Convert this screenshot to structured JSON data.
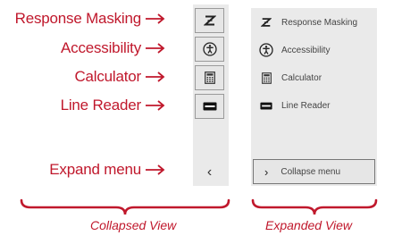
{
  "callouts": [
    {
      "label": "Response Masking"
    },
    {
      "label": "Accessibility"
    },
    {
      "label": "Calculator"
    },
    {
      "label": "Line Reader"
    },
    {
      "label": "Expand menu"
    }
  ],
  "collapsed_panel": {
    "expand_glyph": "‹",
    "tools": [
      {
        "icon": "response-masking-icon"
      },
      {
        "icon": "accessibility-icon"
      },
      {
        "icon": "calculator-icon"
      },
      {
        "icon": "line-reader-icon"
      }
    ]
  },
  "expanded_panel": {
    "items": [
      {
        "label": "Response Masking",
        "icon": "response-masking-icon"
      },
      {
        "label": "Accessibility",
        "icon": "accessibility-icon"
      },
      {
        "label": "Calculator",
        "icon": "calculator-icon"
      },
      {
        "label": "Line Reader",
        "icon": "line-reader-icon"
      }
    ],
    "collapse_glyph": "›",
    "collapse_label": "Collapse menu"
  },
  "captions": {
    "collapsed": "Collapsed View",
    "expanded": "Expanded View"
  },
  "colors": {
    "annotation": "#c0182c",
    "panel_background": "#eaeaea",
    "button_border": "#9a9a9a"
  }
}
